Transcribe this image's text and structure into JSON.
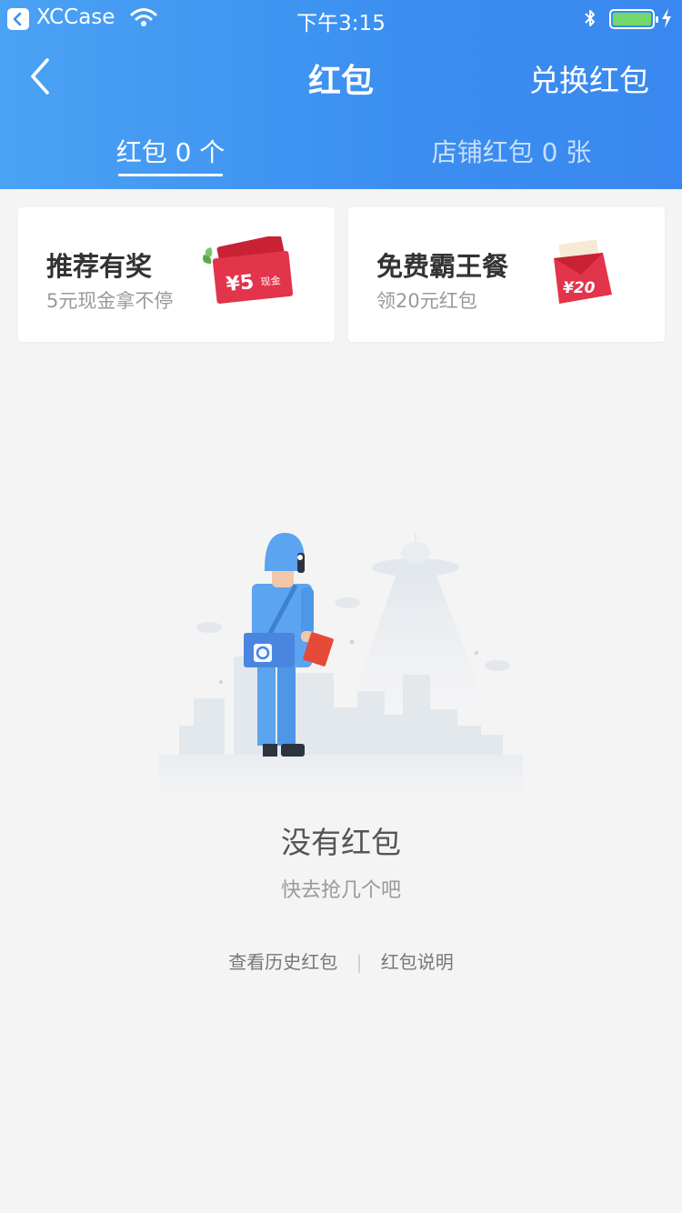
{
  "status_bar": {
    "app": "XCCase",
    "time": "下午3:15"
  },
  "nav": {
    "title": "红包",
    "right_action": "兑换红包"
  },
  "tabs": [
    {
      "label": "红包 0 个",
      "active": true
    },
    {
      "label": "店铺红包 0 张",
      "active": false
    }
  ],
  "promos": [
    {
      "title": "推荐有奖",
      "subtitle": "5元现金拿不停",
      "art_amount": "¥5",
      "art_tag": "现金"
    },
    {
      "title": "免费霸王餐",
      "subtitle": "领20元红包",
      "art_amount": "¥20"
    }
  ],
  "empty": {
    "title": "没有红包",
    "subtitle": "快去抢几个吧"
  },
  "links": {
    "history": "查看历史红包",
    "separator": "|",
    "explain": "红包说明"
  },
  "colors": {
    "header_gradient_start": "#4aa2f4",
    "header_gradient_end": "#3a88ef",
    "background": "#f4f4f4",
    "battery": "#72d86a",
    "red_packet": "#e2344a"
  },
  "icons": [
    "back-app-icon",
    "wifi-icon",
    "bluetooth-icon",
    "battery-icon",
    "charging-icon",
    "back-chevron-icon",
    "cash-ticket-icon",
    "red-packet-icon",
    "courier-illustration"
  ]
}
